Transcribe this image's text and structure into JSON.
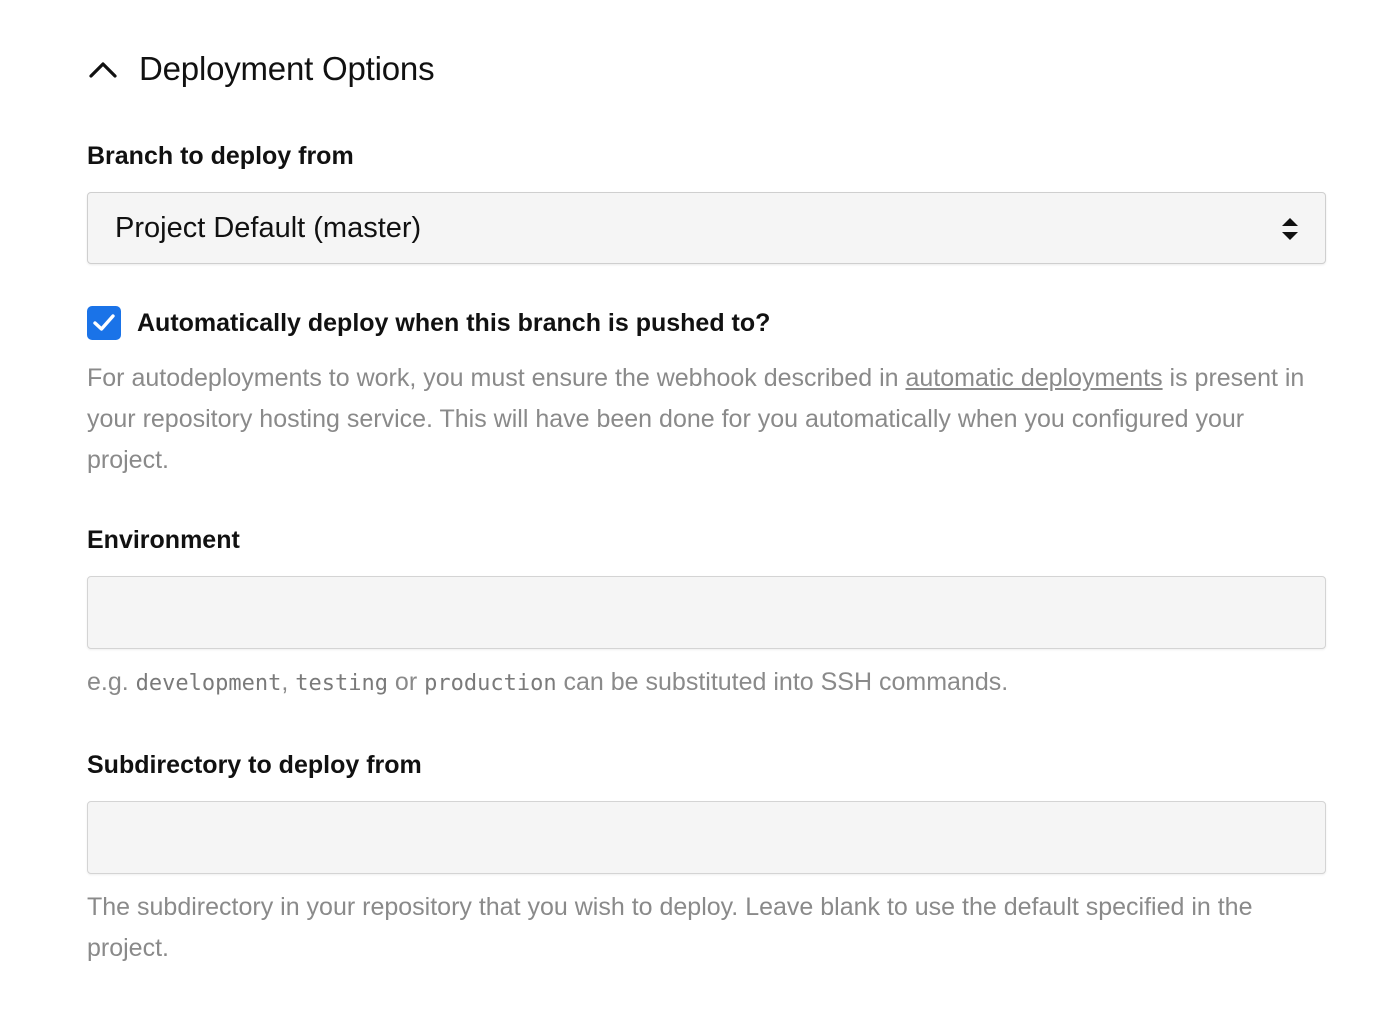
{
  "section": {
    "title": "Deployment Options",
    "toggle_icon": "chevron-up-icon"
  },
  "branch": {
    "label": "Branch to deploy from",
    "selected": "Project Default (master)",
    "arrows_icon": "select-arrows-icon"
  },
  "autodeploy": {
    "checked": true,
    "label": "Automatically deploy when this branch is pushed to?",
    "help_before_link": "For autodeployments to work, you must ensure the webhook described in ",
    "help_link": "automatic deployments",
    "help_after_link": " is present in your repository hosting service. This will have been done for you automatically when you configured your project."
  },
  "environment": {
    "label": "Environment",
    "value": "",
    "help_prefix": "e.g. ",
    "example_1": "development",
    "sep_1": ", ",
    "example_2": "testing",
    "sep_2": " or ",
    "example_3": "production",
    "help_suffix": " can be substituted into SSH commands."
  },
  "subdirectory": {
    "label": "Subdirectory to deploy from",
    "value": "",
    "help": "The subdirectory in your repository that you wish to deploy. Leave blank to use the default specified in the project."
  },
  "colors": {
    "checkbox_accent": "#1a73e8",
    "help_text": "#8a8a8a",
    "field_background": "#f5f5f5"
  }
}
